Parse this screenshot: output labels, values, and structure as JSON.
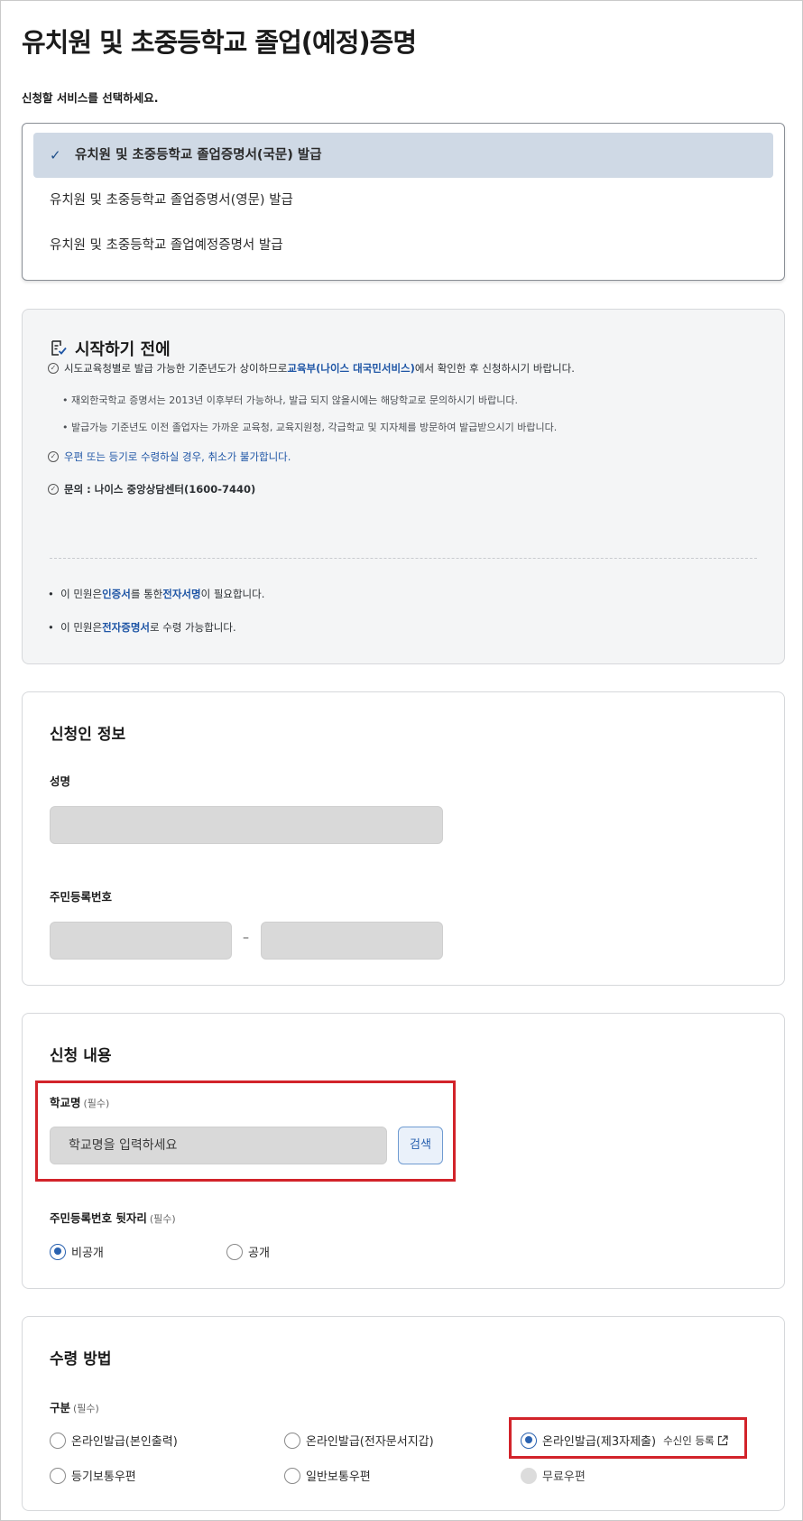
{
  "page_title": "유치원 및 초중등학교 졸업(예정)증명",
  "instruction": "신청할 서비스를 선택하세요.",
  "services": [
    {
      "label": "유치원 및 초중등학교 졸업증명서(국문) 발급",
      "selected": true
    },
    {
      "label": "유치원 및 초중등학교 졸업증명서(영문) 발급",
      "selected": false
    },
    {
      "label": "유치원 및 초중등학교 졸업예정증명서 발급",
      "selected": false
    }
  ],
  "notice": {
    "title": "시작하기 전에",
    "item1_pre": "시도교육청별로 발급 가능한 기준년도가 상이하므로 ",
    "item1_link": "교육부(나이스 대국민서비스)",
    "item1_post": "에서 확인한 후 신청하시기 바랍니다.",
    "sub1": "재외한국학교 증명서는 2013년 이후부터 가능하나, 발급 되지 않을시에는 해당학교로 문의하시기 바랍니다.",
    "sub2": "발급가능 기준년도 이전 졸업자는 가까운 교육청, 교육지원청, 각급학교 및 지자체를 방문하여 발급받으시기 바랍니다.",
    "item2": "우편 또는 등기로 수령하실 경우, 취소가 불가합니다.",
    "item3": "문의 : 나이스 중앙상담센터(1600-7440)",
    "b1_pre": "이 민원은 ",
    "b1_k1": "인증서",
    "b1_mid": "를 통한 ",
    "b1_k2": "전자서명",
    "b1_post": "이 필요합니다.",
    "b2_pre": "이 민원은 ",
    "b2_k": "전자증명서",
    "b2_post": "로 수령 가능합니다."
  },
  "applicant": {
    "title": "신청인 정보",
    "name_label": "성명",
    "rrn_label": "주민등록번호",
    "dash": "–"
  },
  "application": {
    "title": "신청 내용",
    "school_label": "학교명",
    "required": "(필수)",
    "school_placeholder": "학교명을 입력하세요",
    "search_button": "검색",
    "rrn_back_label": "주민등록번호 뒷자리",
    "rrn_options": [
      {
        "label": "비공개",
        "selected": true
      },
      {
        "label": "공개",
        "selected": false
      }
    ]
  },
  "receipt": {
    "title": "수령 방법",
    "type_label": "구분",
    "required": "(필수)",
    "options": [
      {
        "label": "온라인발급(본인출력)",
        "selected": false
      },
      {
        "label": "온라인발급(전자문서지갑)",
        "selected": false
      },
      {
        "label": "온라인발급(제3자제출)",
        "selected": true
      },
      {
        "label": "등기보통우편",
        "selected": false
      },
      {
        "label": "일반보통우편",
        "selected": false
      },
      {
        "label": "무료우편",
        "selected": false,
        "disabled": true
      }
    ],
    "recipient_link": "수신인 등록"
  }
}
